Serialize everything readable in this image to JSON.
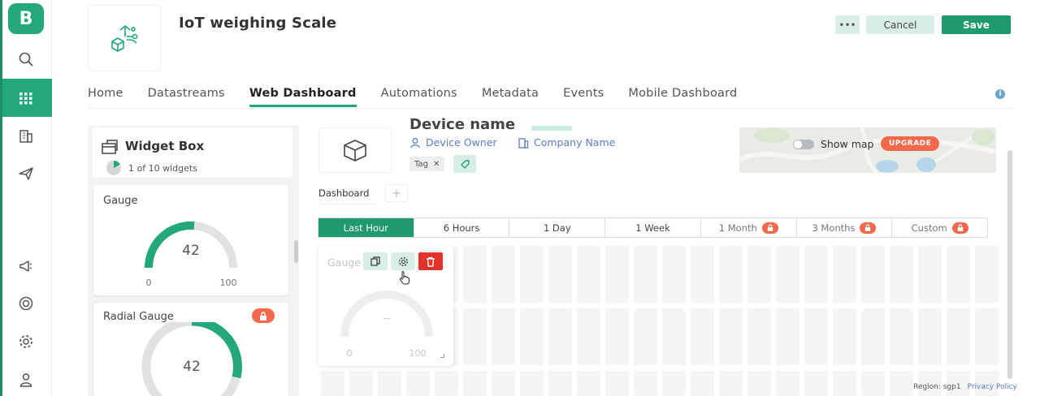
{
  "nav": {
    "logo_letter": "B",
    "items": [
      "search-icon",
      "apps-grid-icon",
      "building-icon",
      "send-icon",
      "megaphone-icon",
      "lifebuoy-icon",
      "gear-icon",
      "user-icon"
    ]
  },
  "header": {
    "title": "IoT weighing Scale",
    "more_label": "•••",
    "cancel_label": "Cancel",
    "save_label": "Save"
  },
  "tabs": [
    {
      "label": "Home",
      "active": false
    },
    {
      "label": "Datastreams",
      "active": false
    },
    {
      "label": "Web Dashboard",
      "active": true
    },
    {
      "label": "Automations",
      "active": false
    },
    {
      "label": "Metadata",
      "active": false
    },
    {
      "label": "Events",
      "active": false
    },
    {
      "label": "Mobile Dashboard",
      "active": false
    }
  ],
  "widget_box": {
    "title": "Widget Box",
    "count_text": "1 of 10 widgets",
    "widgets": [
      {
        "title": "Gauge",
        "value": "42",
        "min": "0",
        "max": "100",
        "locked": false
      },
      {
        "title": "Radial Gauge",
        "value": "42",
        "locked": true
      }
    ]
  },
  "device": {
    "name": "Device name",
    "owner_label": "Device Owner",
    "company_label": "Company Name",
    "tag_label": "Tag",
    "show_map_label": "Show map",
    "upgrade_label": "UPGRADE"
  },
  "dashboard": {
    "tab_label": "Dashboard",
    "add_label": "+",
    "time_ranges": [
      {
        "label": "Last Hour",
        "active": true,
        "locked": false
      },
      {
        "label": "6 Hours",
        "active": false,
        "locked": false
      },
      {
        "label": "1 Day",
        "active": false,
        "locked": false
      },
      {
        "label": "1 Week",
        "active": false,
        "locked": false
      },
      {
        "label": "1 Month",
        "active": false,
        "locked": true
      },
      {
        "label": "3 Months",
        "active": false,
        "locked": true
      },
      {
        "label": "Custom",
        "active": false,
        "locked": true
      }
    ],
    "gauge_widget": {
      "title": "Gauge",
      "value": "--",
      "min": "0",
      "max": "100"
    }
  },
  "footer": {
    "region": "Region: sgp1",
    "privacy": "Privacy Policy"
  },
  "colors": {
    "brand": "#23a87a",
    "primary_button": "#1f9a6c",
    "secondary_button": "#d9efe6",
    "lock": "#f26a4b",
    "danger": "#e0342b",
    "link": "#5d7dc7"
  }
}
